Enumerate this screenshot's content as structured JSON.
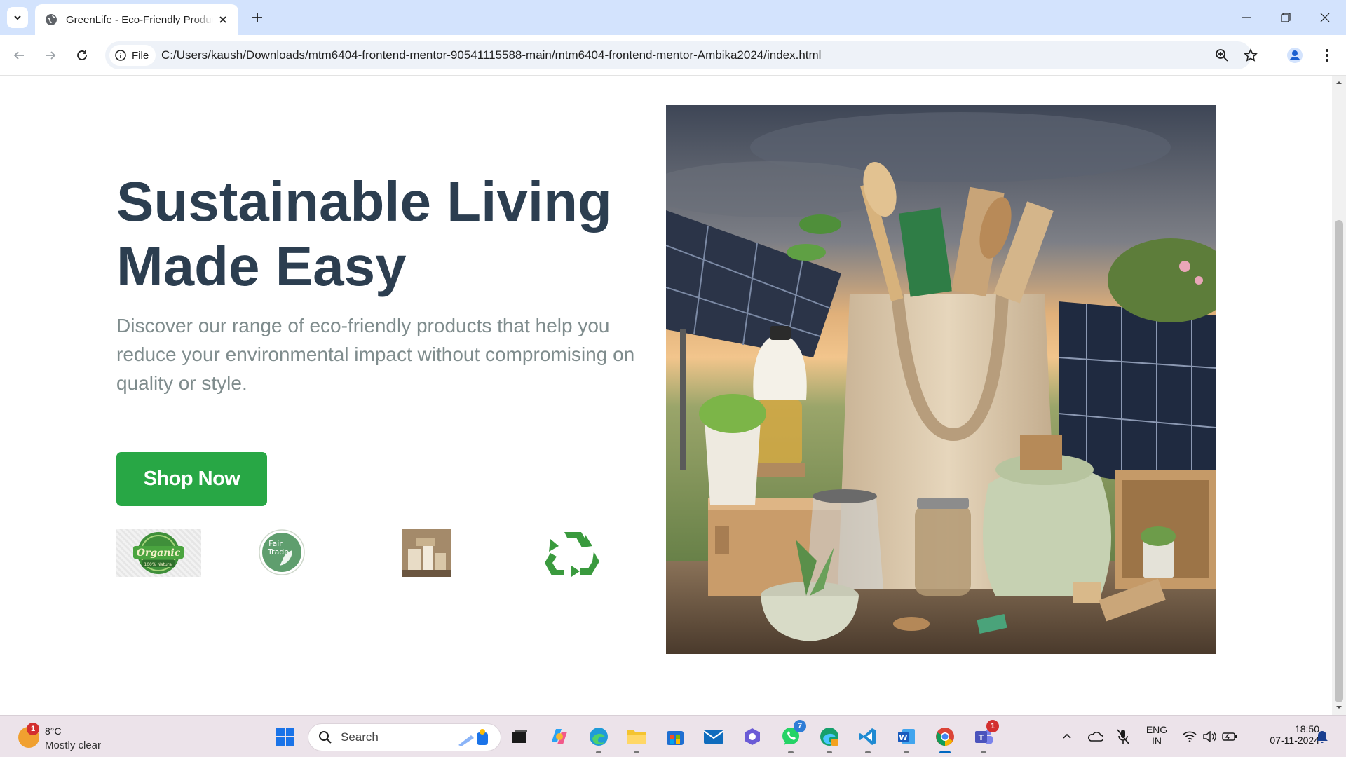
{
  "browser": {
    "tab_title": "GreenLife - Eco-Friendly Products",
    "site_chip_label": "File",
    "url": "C:/Users/kaush/Downloads/mtm6404-frontend-mentor-90541115588-main/mtm6404-frontend-mentor-Ambika2024/index.html"
  },
  "hero": {
    "title_line1": "Sustainable Living",
    "title_line2": "Made Easy",
    "description": "Discover our range of eco-friendly products that help you reduce your environmental impact without compromising on quality or style.",
    "cta_label": "Shop Now",
    "badges": {
      "organic_top": "Organic",
      "organic_bottom": "100% Natural",
      "fairtrade_top": "Fair",
      "fairtrade_bottom": "Trade"
    }
  },
  "taskbar": {
    "weather_temp": "8°C",
    "weather_condition": "Mostly clear",
    "weather_badge": "1",
    "search_placeholder": "Search",
    "whatsapp_badge": "7",
    "teams_badge": "1",
    "language_line1": "ENG",
    "language_line2": "IN",
    "time": "18:50",
    "date": "07-11-2024"
  },
  "colors": {
    "title": "#2c3e50",
    "description": "#7f8c8d",
    "cta_background": "#28a745",
    "tabstrip": "#d3e3fd"
  }
}
